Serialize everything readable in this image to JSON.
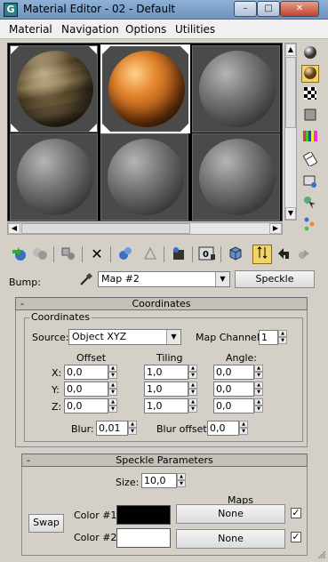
{
  "window": {
    "title": "Material Editor - 02 - Default",
    "app_icon_letter": "G",
    "controls": {
      "minimize": "–",
      "maximize": "□",
      "close": "✕"
    }
  },
  "menu": {
    "items": [
      "Material",
      "Navigation",
      "Options",
      "Utilities"
    ]
  },
  "preview": {
    "slots": [
      {
        "material": "wood",
        "selected": false,
        "corners": true
      },
      {
        "material": "orange-speckle",
        "selected": true,
        "corners": true
      },
      {
        "material": "default-gray",
        "selected": false,
        "corners": false
      },
      {
        "material": "default-gray",
        "selected": false,
        "corners": false
      },
      {
        "material": "default-gray",
        "selected": false,
        "corners": false
      },
      {
        "material": "default-gray",
        "selected": false,
        "corners": false
      }
    ]
  },
  "bump": {
    "label": "Bump:",
    "map_name": "Map #2",
    "map_type_button": "Speckle"
  },
  "coordinates_rollout": {
    "toggle": "-",
    "title": "Coordinates",
    "group_title": "Coordinates",
    "source_label": "Source:",
    "source_value": "Object XYZ",
    "map_channel_label": "Map Channel:",
    "map_channel_value": "1",
    "columns": {
      "offset": "Offset",
      "tiling": "Tiling",
      "angle": "Angle:"
    },
    "rows": [
      {
        "axis": "X:",
        "offset": "0,0",
        "tiling": "1,0",
        "angle": "0,0"
      },
      {
        "axis": "Y:",
        "offset": "0,0",
        "tiling": "1,0",
        "angle": "0,0"
      },
      {
        "axis": "Z:",
        "offset": "0,0",
        "tiling": "1,0",
        "angle": "0,0"
      }
    ],
    "blur_label": "Blur:",
    "blur_value": "0,01",
    "blur_offset_label": "Blur offset:",
    "blur_offset_value": "0,0"
  },
  "speckle_rollout": {
    "toggle": "-",
    "title": "Speckle Parameters",
    "size_label": "Size:",
    "size_value": "10,0",
    "maps_label": "Maps",
    "swap_button": "Swap",
    "color1_label": "Color #1",
    "color1_hex": "#000000",
    "color1_map": "None",
    "color1_map_enabled": true,
    "color2_label": "Color #2",
    "color2_hex": "#ffffff",
    "color2_map": "None",
    "color2_map_enabled": true,
    "check_glyph": "✓"
  },
  "icons": {
    "right_toolbar": [
      "sample-type-sphere-icon",
      "backlight-icon",
      "background-checker-icon",
      "sample-uv-tiling-icon",
      "video-color-check-icon",
      "make-preview-icon",
      "options-icon",
      "select-by-material-icon",
      "material-map-navigator-icon"
    ],
    "bottom_toolbar": [
      "get-material-icon",
      "put-to-scene-icon",
      "assign-to-selection-icon",
      "reset-map-icon",
      "make-copy-icon",
      "make-unique-icon",
      "put-to-library-icon",
      "material-id-channel-icon",
      "show-in-viewport-icon",
      "show-end-result-icon",
      "go-to-parent-icon",
      "go-forward-to-sibling-icon"
    ]
  },
  "colors": {
    "panel": "#d4d0c8",
    "active_tool": "#f5d36b",
    "titlebar": "#7fa3ca"
  }
}
